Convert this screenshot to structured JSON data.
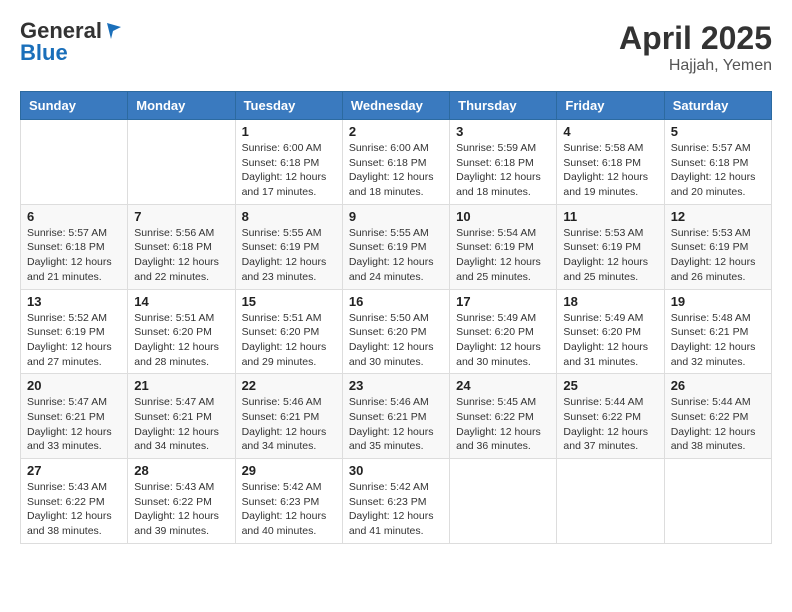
{
  "header": {
    "logo_general": "General",
    "logo_blue": "Blue",
    "title": "April 2025",
    "location": "Hajjah, Yemen"
  },
  "columns": [
    "Sunday",
    "Monday",
    "Tuesday",
    "Wednesday",
    "Thursday",
    "Friday",
    "Saturday"
  ],
  "weeks": [
    [
      {
        "day": "",
        "info": ""
      },
      {
        "day": "",
        "info": ""
      },
      {
        "day": "1",
        "info": "Sunrise: 6:00 AM\nSunset: 6:18 PM\nDaylight: 12 hours and 17 minutes."
      },
      {
        "day": "2",
        "info": "Sunrise: 6:00 AM\nSunset: 6:18 PM\nDaylight: 12 hours and 18 minutes."
      },
      {
        "day": "3",
        "info": "Sunrise: 5:59 AM\nSunset: 6:18 PM\nDaylight: 12 hours and 18 minutes."
      },
      {
        "day": "4",
        "info": "Sunrise: 5:58 AM\nSunset: 6:18 PM\nDaylight: 12 hours and 19 minutes."
      },
      {
        "day": "5",
        "info": "Sunrise: 5:57 AM\nSunset: 6:18 PM\nDaylight: 12 hours and 20 minutes."
      }
    ],
    [
      {
        "day": "6",
        "info": "Sunrise: 5:57 AM\nSunset: 6:18 PM\nDaylight: 12 hours and 21 minutes."
      },
      {
        "day": "7",
        "info": "Sunrise: 5:56 AM\nSunset: 6:18 PM\nDaylight: 12 hours and 22 minutes."
      },
      {
        "day": "8",
        "info": "Sunrise: 5:55 AM\nSunset: 6:19 PM\nDaylight: 12 hours and 23 minutes."
      },
      {
        "day": "9",
        "info": "Sunrise: 5:55 AM\nSunset: 6:19 PM\nDaylight: 12 hours and 24 minutes."
      },
      {
        "day": "10",
        "info": "Sunrise: 5:54 AM\nSunset: 6:19 PM\nDaylight: 12 hours and 25 minutes."
      },
      {
        "day": "11",
        "info": "Sunrise: 5:53 AM\nSunset: 6:19 PM\nDaylight: 12 hours and 25 minutes."
      },
      {
        "day": "12",
        "info": "Sunrise: 5:53 AM\nSunset: 6:19 PM\nDaylight: 12 hours and 26 minutes."
      }
    ],
    [
      {
        "day": "13",
        "info": "Sunrise: 5:52 AM\nSunset: 6:19 PM\nDaylight: 12 hours and 27 minutes."
      },
      {
        "day": "14",
        "info": "Sunrise: 5:51 AM\nSunset: 6:20 PM\nDaylight: 12 hours and 28 minutes."
      },
      {
        "day": "15",
        "info": "Sunrise: 5:51 AM\nSunset: 6:20 PM\nDaylight: 12 hours and 29 minutes."
      },
      {
        "day": "16",
        "info": "Sunrise: 5:50 AM\nSunset: 6:20 PM\nDaylight: 12 hours and 30 minutes."
      },
      {
        "day": "17",
        "info": "Sunrise: 5:49 AM\nSunset: 6:20 PM\nDaylight: 12 hours and 30 minutes."
      },
      {
        "day": "18",
        "info": "Sunrise: 5:49 AM\nSunset: 6:20 PM\nDaylight: 12 hours and 31 minutes."
      },
      {
        "day": "19",
        "info": "Sunrise: 5:48 AM\nSunset: 6:21 PM\nDaylight: 12 hours and 32 minutes."
      }
    ],
    [
      {
        "day": "20",
        "info": "Sunrise: 5:47 AM\nSunset: 6:21 PM\nDaylight: 12 hours and 33 minutes."
      },
      {
        "day": "21",
        "info": "Sunrise: 5:47 AM\nSunset: 6:21 PM\nDaylight: 12 hours and 34 minutes."
      },
      {
        "day": "22",
        "info": "Sunrise: 5:46 AM\nSunset: 6:21 PM\nDaylight: 12 hours and 34 minutes."
      },
      {
        "day": "23",
        "info": "Sunrise: 5:46 AM\nSunset: 6:21 PM\nDaylight: 12 hours and 35 minutes."
      },
      {
        "day": "24",
        "info": "Sunrise: 5:45 AM\nSunset: 6:22 PM\nDaylight: 12 hours and 36 minutes."
      },
      {
        "day": "25",
        "info": "Sunrise: 5:44 AM\nSunset: 6:22 PM\nDaylight: 12 hours and 37 minutes."
      },
      {
        "day": "26",
        "info": "Sunrise: 5:44 AM\nSunset: 6:22 PM\nDaylight: 12 hours and 38 minutes."
      }
    ],
    [
      {
        "day": "27",
        "info": "Sunrise: 5:43 AM\nSunset: 6:22 PM\nDaylight: 12 hours and 38 minutes."
      },
      {
        "day": "28",
        "info": "Sunrise: 5:43 AM\nSunset: 6:22 PM\nDaylight: 12 hours and 39 minutes."
      },
      {
        "day": "29",
        "info": "Sunrise: 5:42 AM\nSunset: 6:23 PM\nDaylight: 12 hours and 40 minutes."
      },
      {
        "day": "30",
        "info": "Sunrise: 5:42 AM\nSunset: 6:23 PM\nDaylight: 12 hours and 41 minutes."
      },
      {
        "day": "",
        "info": ""
      },
      {
        "day": "",
        "info": ""
      },
      {
        "day": "",
        "info": ""
      }
    ]
  ]
}
